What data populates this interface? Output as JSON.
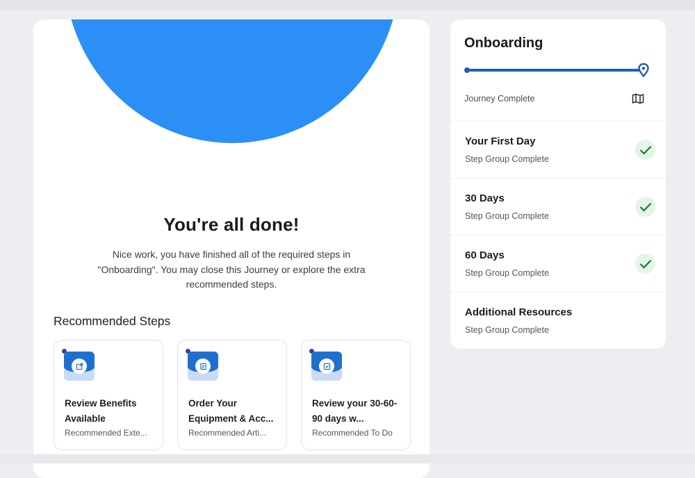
{
  "main": {
    "title": "You're all done!",
    "message": "Nice work, you have finished all of the required steps in \"Onboarding\". You may close this Journey or explore the extra recommended steps.",
    "recommended_heading": "Recommended Steps",
    "recommended": [
      {
        "title": "Review Benefits Available",
        "subtitle": "Recommended Exte...",
        "icon": "external-link-icon"
      },
      {
        "title": "Order Your Equipment & Acc...",
        "subtitle": "Recommended Arti...",
        "icon": "article-icon"
      },
      {
        "title": "Review your 30-60-90 days w...",
        "subtitle": "Recommended To Do",
        "icon": "checkbox-icon"
      }
    ]
  },
  "sidebar": {
    "title": "Onboarding",
    "progress_fraction": 1.0,
    "status": "Journey Complete",
    "map_icon": "map-icon",
    "steps": [
      {
        "name": "Your First Day",
        "status": "Step Group Complete",
        "completed": true
      },
      {
        "name": "30 Days",
        "status": "Step Group Complete",
        "completed": true
      },
      {
        "name": "60 Days",
        "status": "Step Group Complete",
        "completed": true
      },
      {
        "name": "Additional Resources",
        "status": "Step Group Complete",
        "completed": false
      }
    ]
  },
  "colors": {
    "hero_blue": "#2b8ff5",
    "progress_blue": "#1d5fb8",
    "check_green": "#1e7b34",
    "check_bg": "#e4f5e6"
  }
}
